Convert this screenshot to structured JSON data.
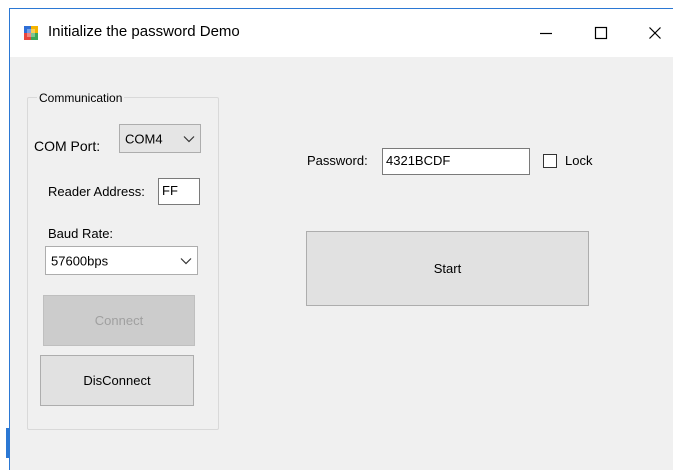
{
  "window": {
    "title": "Initialize the password Demo"
  },
  "title_buttons": {
    "minimize": "—",
    "maximize": "☐",
    "close": "✕"
  },
  "communication": {
    "group_title": "Communication",
    "com_port_label": "COM Port:",
    "com_port_value": "COM4",
    "reader_address_label": "Reader Address:",
    "reader_address_value": "FF",
    "baud_rate_label": "Baud Rate:",
    "baud_rate_value": "57600bps",
    "connect_label": "Connect",
    "disconnect_label": "DisConnect"
  },
  "password_panel": {
    "password_label": "Password:",
    "password_value": "4321BCDF",
    "lock_label": "Lock",
    "start_label": "Start"
  },
  "colors": {
    "accent": "#2b78d4",
    "window_bg": "#f0f0f0",
    "button_bg": "#e1e1e1"
  }
}
